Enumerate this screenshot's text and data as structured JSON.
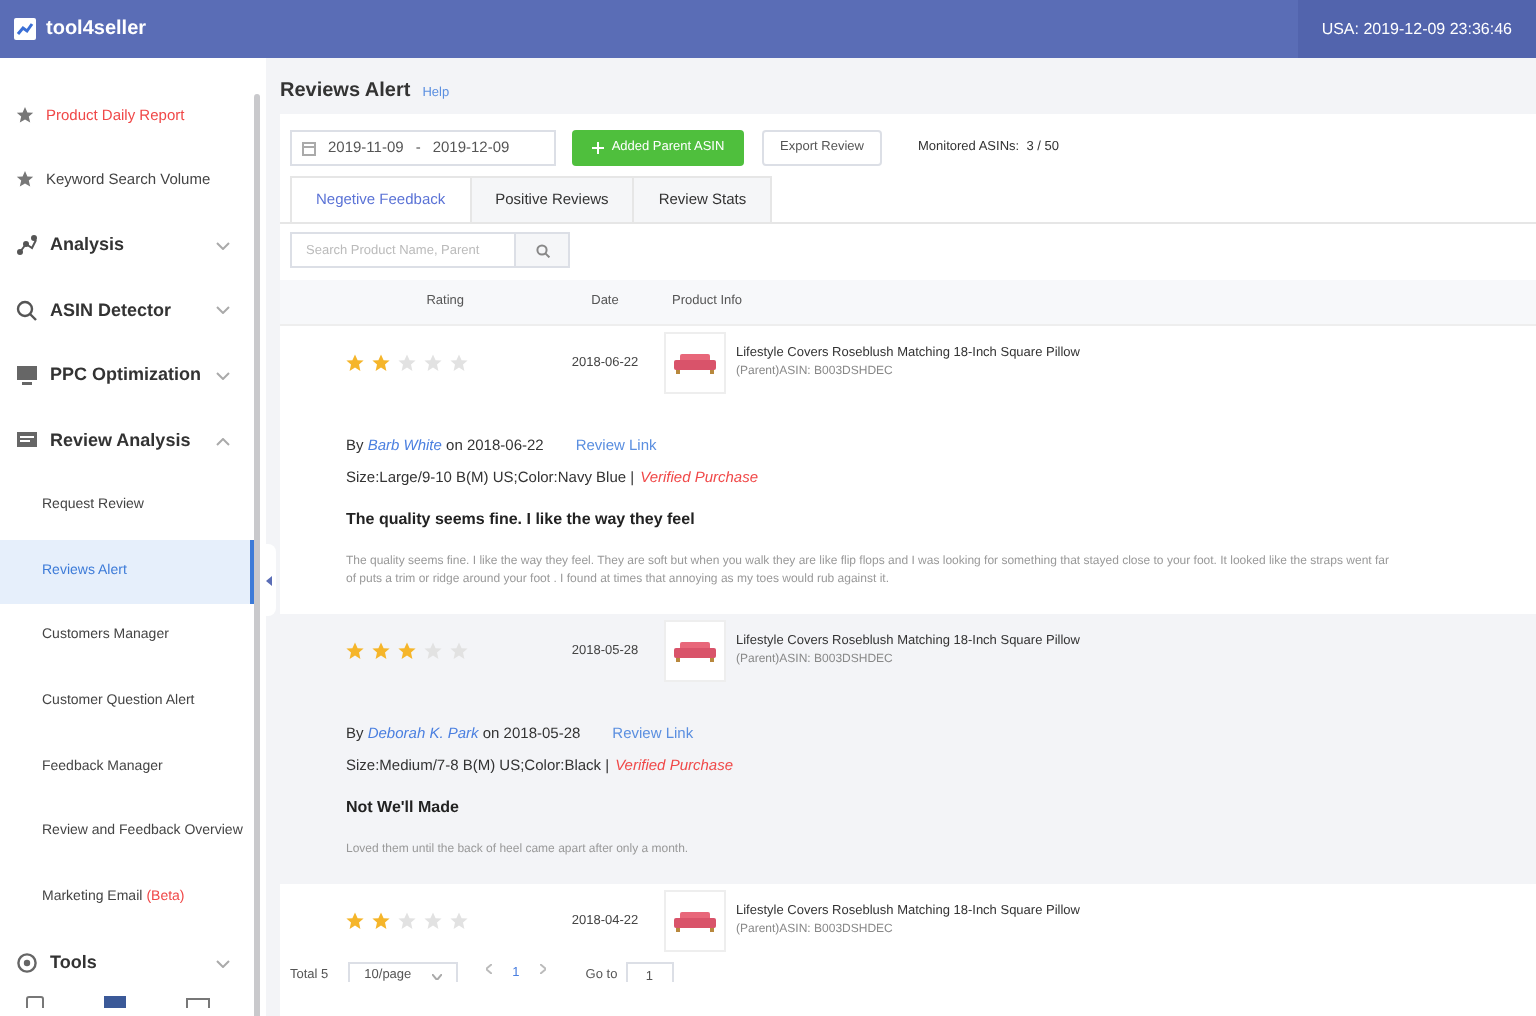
{
  "header": {
    "logo": "tool4seller",
    "time": "USA: 2019-12-09 23:36:46"
  },
  "sidebar": {
    "items": [
      {
        "kind": "link",
        "label": "Product Daily Report",
        "highlighted": true
      },
      {
        "kind": "link",
        "label": "Keyword Search Volume",
        "highlighted": false
      },
      {
        "kind": "group",
        "label": "Analysis",
        "expanded": false
      },
      {
        "kind": "group",
        "label": "ASIN Detector",
        "expanded": false
      },
      {
        "kind": "group",
        "label": "PPC Optimization",
        "expanded": false
      },
      {
        "kind": "group",
        "label": "Review Analysis",
        "expanded": true,
        "children": [
          {
            "label": "Request Review",
            "selected": false
          },
          {
            "label": "Reviews Alert",
            "selected": true
          },
          {
            "label": "Customers Manager",
            "selected": false
          },
          {
            "label": "Customer Question Alert",
            "selected": false
          },
          {
            "label": "Feedback Manager",
            "selected": false
          },
          {
            "label": "Review and Feedback Overview",
            "selected": false
          },
          {
            "label": "Marketing Email",
            "badge": "(Beta)",
            "selected": false
          }
        ]
      },
      {
        "kind": "group",
        "label": "Tools",
        "expanded": false
      }
    ]
  },
  "page": {
    "title": "Reviews Alert",
    "help": "Help",
    "date_range": {
      "start": "2019-11-09",
      "separator": "-",
      "end": "2019-12-09"
    },
    "add_button": "Added Parent ASIN",
    "export_button": "Export Review",
    "monitored": "Monitored ASINs:  3 / 50",
    "tabs": [
      {
        "label": "Negetive Feedback",
        "selected": true
      },
      {
        "label": "Positive Reviews",
        "selected": false
      },
      {
        "label": "Review Stats",
        "selected": false
      }
    ],
    "search": {
      "placeholder": "Search Product Name, Parent"
    },
    "table": {
      "columns": [
        "Rating",
        "Date",
        "Product Info"
      ],
      "rows": [
        {
          "stars": 2,
          "date": "2018-06-22",
          "product": "Lifestyle Covers Roseblush Matching 18-Inch Square Pillow",
          "asin": "(Parent)ASIN: B003DSHDEC",
          "hovered": false,
          "review": {
            "by": "By",
            "author": "Barb White",
            "on": "on 2018-06-22",
            "link": "Review Link",
            "variant": "Size:Large/9-10 B(M) US;Color:Navy Blue |",
            "verified": "Verified Purchase",
            "title": "The quality seems fine. I like the way they feel",
            "body_lines": [
              "The quality seems fine. I like the way they feel. They are soft but when you walk they are like flip flops and I was looking for something that stayed close to your foot. It looked like the straps went far",
              "of puts a trim or ridge around your foot . I found at times that annoying as my toes would rub against it."
            ]
          }
        },
        {
          "stars": 3,
          "date": "2018-05-28",
          "product": "Lifestyle Covers Roseblush Matching 18-Inch Square Pillow",
          "asin": "(Parent)ASIN: B003DSHDEC",
          "hovered": true,
          "review": {
            "by": "By",
            "author": "Deborah K. Park",
            "on": "on 2018-05-28",
            "link": "Review Link",
            "variant": "Size:Medium/7-8 B(M) US;Color:Black |",
            "verified": "Verified Purchase",
            "title": "Not We'll Made",
            "body_lines": [
              "Loved them until the back of heel came apart after only a month."
            ]
          }
        },
        {
          "stars": 2,
          "date": "2018-04-22",
          "product": "Lifestyle Covers Roseblush Matching 18-Inch Square Pillow",
          "asin": "(Parent)ASIN: B003DSHDEC",
          "hovered": false
        }
      ]
    },
    "pagination": {
      "total": "Total 5",
      "page_size": "10/page",
      "current": "1",
      "goto_label": "Go to",
      "goto_value": "1"
    }
  }
}
